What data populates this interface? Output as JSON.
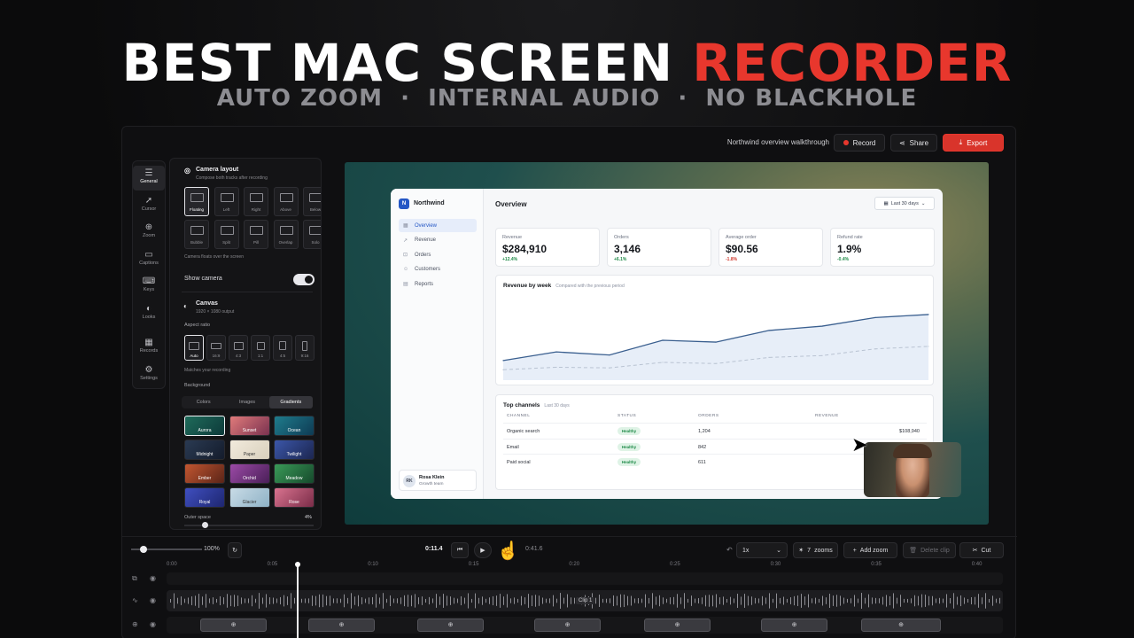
{
  "headline": {
    "main": "BEST MAC SCREEN",
    "accent": "RECORDER",
    "sub": "AUTO ZOOM  ·  INTERNAL AUDIO  ·  NO BLACKHOLE"
  },
  "colors": {
    "accent": "#e8372d",
    "dashboard_blue": "#2457c5",
    "healthy_green": "#1f8a48"
  },
  "topbar": {
    "title": "Northwind overview walkthrough",
    "record": "Record",
    "share": "Share",
    "export": "Export"
  },
  "rail": [
    {
      "label": "General",
      "icon": "sliders-icon"
    },
    {
      "label": "Cursor",
      "icon": "cursor-icon"
    },
    {
      "label": "Zoom",
      "icon": "zoom-icon"
    },
    {
      "label": "Captions",
      "icon": "captions-icon"
    },
    {
      "label": "Keys",
      "icon": "keyboard-icon"
    },
    {
      "label": "Looks",
      "icon": "palette-icon"
    },
    {
      "label": "Records",
      "icon": "film-icon"
    },
    {
      "label": "Settings",
      "icon": "gear-icon"
    }
  ],
  "panel": {
    "camera_title": "Camera layout",
    "camera_sub": "Compose both tracks after recording",
    "layouts": [
      "Floating",
      "Left",
      "Right",
      "Above",
      "Below",
      "Bubble",
      "Split",
      "Pill",
      "Overlap",
      "Solo"
    ],
    "camera_note": "Camera floats over the screen",
    "show_camera": "Show camera",
    "canvas_title": "Canvas",
    "canvas_sub": "1920 × 1080 output",
    "aspect_label": "Aspect ratio",
    "ratios": [
      "Auto",
      "16:9",
      "4:3",
      "1:1",
      "4:5",
      "9:16"
    ],
    "ratio_note": "Matches your recording",
    "background_label": "Background",
    "bg_tabs": [
      "Colors",
      "Images",
      "Gradients"
    ],
    "swatches": [
      {
        "name": "Aurora",
        "c1": "#1f6b5a",
        "c2": "#0d3a3a"
      },
      {
        "name": "Sunset",
        "c1": "#e07a7a",
        "c2": "#7a3250"
      },
      {
        "name": "Ocean",
        "c1": "#1f7c8c",
        "c2": "#0e3b54"
      },
      {
        "name": "Midnight",
        "c1": "#2a3a52",
        "c2": "#141c2c"
      },
      {
        "name": "Paper",
        "c1": "#f1eadc",
        "c2": "#d9d0bd"
      },
      {
        "name": "Twilight",
        "c1": "#3b56a8",
        "c2": "#1c2650"
      },
      {
        "name": "Ember",
        "c1": "#c25630",
        "c2": "#5a2418"
      },
      {
        "name": "Orchid",
        "c1": "#9b4aa6",
        "c2": "#4a1f58"
      },
      {
        "name": "Meadow",
        "c1": "#3a9a58",
        "c2": "#164a2c"
      },
      {
        "name": "Royal",
        "c1": "#3f4fc0",
        "c2": "#1e2670"
      },
      {
        "name": "Glacier",
        "c1": "#c8dbe6",
        "c2": "#8fb2c6"
      },
      {
        "name": "Rose",
        "c1": "#d9738f",
        "c2": "#7a2c48"
      }
    ],
    "outer_label": "Outer space",
    "outer_value": "4%"
  },
  "dashboard": {
    "brand": "Northwind",
    "logo": "N",
    "nav": [
      "Overview",
      "Revenue",
      "Orders",
      "Customers",
      "Reports"
    ],
    "title": "Overview",
    "filter": "Last 30 days",
    "kpis": [
      {
        "label": "Revenue",
        "value": "$284,910",
        "delta": "+12.4%",
        "up": true
      },
      {
        "label": "Orders",
        "value": "3,146",
        "delta": "+6.1%",
        "up": true
      },
      {
        "label": "Average order",
        "value": "$90.56",
        "delta": "-1.8%",
        "up": false
      },
      {
        "label": "Refund rate",
        "value": "1.9%",
        "delta": "-0.4%",
        "up": true
      }
    ],
    "chart": {
      "title": "Revenue by week",
      "subtitle": "Compared with the previous period"
    },
    "table": {
      "title": "Top channels",
      "subtitle": "Last 30 days",
      "headers": [
        "CHANNEL",
        "STATUS",
        "ORDERS",
        "REVENUE"
      ],
      "rows": [
        {
          "channel": "Organic search",
          "status": "Healthy",
          "orders": "1,204",
          "revenue": "$108,940"
        },
        {
          "channel": "Email",
          "status": "Healthy",
          "orders": "842",
          "revenue": "$71,206"
        },
        {
          "channel": "Paid social",
          "status": "Healthy",
          "orders": "611",
          "revenue": "$54,318"
        }
      ]
    },
    "user": {
      "initials": "RK",
      "name": "Rosa Klein",
      "team": "Growth team"
    }
  },
  "chart_data": {
    "type": "area",
    "title": "Revenue by week",
    "subtitle": "Compared with the previous period",
    "series": [
      {
        "values": [
          3.2,
          4.6,
          4.1,
          6.5,
          6.2,
          8.1,
          8.8,
          10.2,
          10.7
        ]
      },
      {
        "values": [
          1.7,
          2.1,
          2.0,
          2.9,
          2.7,
          3.7,
          4.0,
          5.1,
          5.5
        ]
      }
    ],
    "ylim": [
      0,
      13
    ],
    "grid": false
  },
  "timeline": {
    "zoom_pct": "100%",
    "zoom_level": 0.17,
    "current": "0:11.4",
    "total": "0:41.6",
    "speed": "1x",
    "zooms_count": "7",
    "zooms_label": "zooms",
    "add_zoom": "Add zoom",
    "delete_clip": "Delete clip",
    "cut": "Cut",
    "ruler": [
      "0:00",
      "0:05",
      "0:10",
      "0:15",
      "0:20",
      "0:25",
      "0:30",
      "0:35",
      "0:40"
    ],
    "clip_label": "Clip 1"
  }
}
